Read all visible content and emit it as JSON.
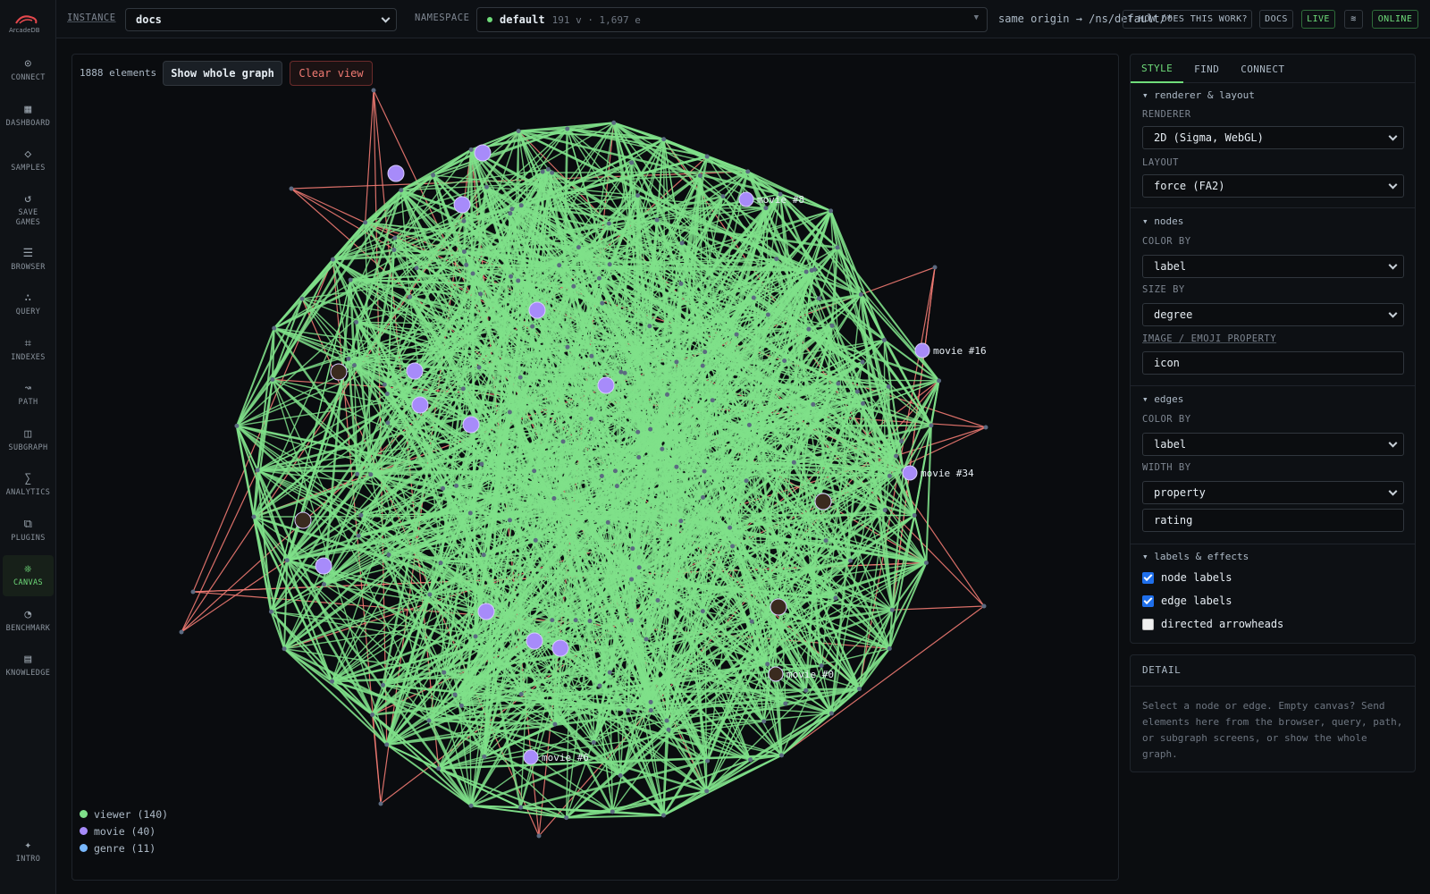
{
  "sidebar": {
    "logo_text": "ArcadeDB",
    "items": [
      {
        "label": "CONNECT",
        "icon": "connect-icon",
        "glyph": "⊙"
      },
      {
        "label": "DASHBOARD",
        "icon": "dashboard-icon",
        "glyph": "▦"
      },
      {
        "label": "SAMPLES",
        "icon": "samples-icon",
        "glyph": "◇"
      },
      {
        "label": "SAVE\nGAMES",
        "icon": "save-games-icon",
        "glyph": "↺"
      },
      {
        "label": "BROWSER",
        "icon": "browser-icon",
        "glyph": "☰"
      },
      {
        "label": "QUERY",
        "icon": "query-icon",
        "glyph": "∴"
      },
      {
        "label": "INDEXES",
        "icon": "indexes-icon",
        "glyph": "⌗"
      },
      {
        "label": "PATH",
        "icon": "path-icon",
        "glyph": "↝"
      },
      {
        "label": "SUBGRAPH",
        "icon": "subgraph-icon",
        "glyph": "◫"
      },
      {
        "label": "ANALYTICS",
        "icon": "analytics-icon",
        "glyph": "∑"
      },
      {
        "label": "PLUGINS",
        "icon": "plugins-icon",
        "glyph": "⧉"
      },
      {
        "label": "CANVAS",
        "icon": "canvas-icon",
        "glyph": "❊"
      },
      {
        "label": "BENCHMARK",
        "icon": "benchmark-icon",
        "glyph": "◔"
      },
      {
        "label": "KNOWLEDGE",
        "icon": "knowledge-icon",
        "glyph": "▤"
      }
    ],
    "intro": {
      "label": "INTRO",
      "glyph": "✦"
    }
  },
  "topbar": {
    "instance_label": "INSTANCE",
    "instance_value": "docs",
    "namespace_label": "NAMESPACE",
    "namespace_value": "default",
    "namespace_meta": "191 v · 1,697 e",
    "origin": "same origin → /ns/default/*",
    "help": "? HOW DOES THIS WORK?",
    "docs": "DOCS",
    "live": "LIVE",
    "wave": "≋",
    "online": "ONLINE"
  },
  "canvas": {
    "element_count": "1888 elements",
    "show_whole": "Show whole graph",
    "clear_view": "Clear view",
    "legend": [
      {
        "label": "viewer (140)",
        "color": "#7fe08a"
      },
      {
        "label": "movie (40)",
        "color": "#a78bfa"
      },
      {
        "label": "genre (11)",
        "color": "#79b8ff"
      }
    ],
    "node_labels": [
      "movie #8",
      "movie #16",
      "movie #34",
      "movie #0",
      "movie #6"
    ],
    "edge_color": "#7fe08a",
    "alt_edge_color": "#f07a72"
  },
  "style": {
    "tabs": [
      "STYLE",
      "FIND",
      "CONNECT"
    ],
    "renderer_section": "▾ renderer & layout",
    "renderer_label": "RENDERER",
    "renderer_value": "2D (Sigma, WebGL)",
    "layout_label": "LAYOUT",
    "layout_value": "force (FA2)",
    "nodes_section": "▾ nodes",
    "color_by_label": "COLOR BY",
    "node_color_by": "label",
    "size_by_label": "SIZE BY",
    "size_by": "degree",
    "image_label": "IMAGE / EMOJI PROPERTY",
    "image_value": "icon",
    "edges_section": "▾ edges",
    "edge_color_label": "COLOR BY",
    "edge_color_by": "label",
    "width_by_label": "WIDTH BY",
    "width_by": "property",
    "width_property": "rating",
    "effects_section": "▾ labels & effects",
    "node_labels": "node labels",
    "edge_labels": "edge labels",
    "arrowheads": "directed arrowheads"
  },
  "detail": {
    "title": "DETAIL",
    "text": "Select a node or edge. Empty canvas? Send elements here from the browser, query, path, or subgraph screens, or show the whole graph."
  }
}
